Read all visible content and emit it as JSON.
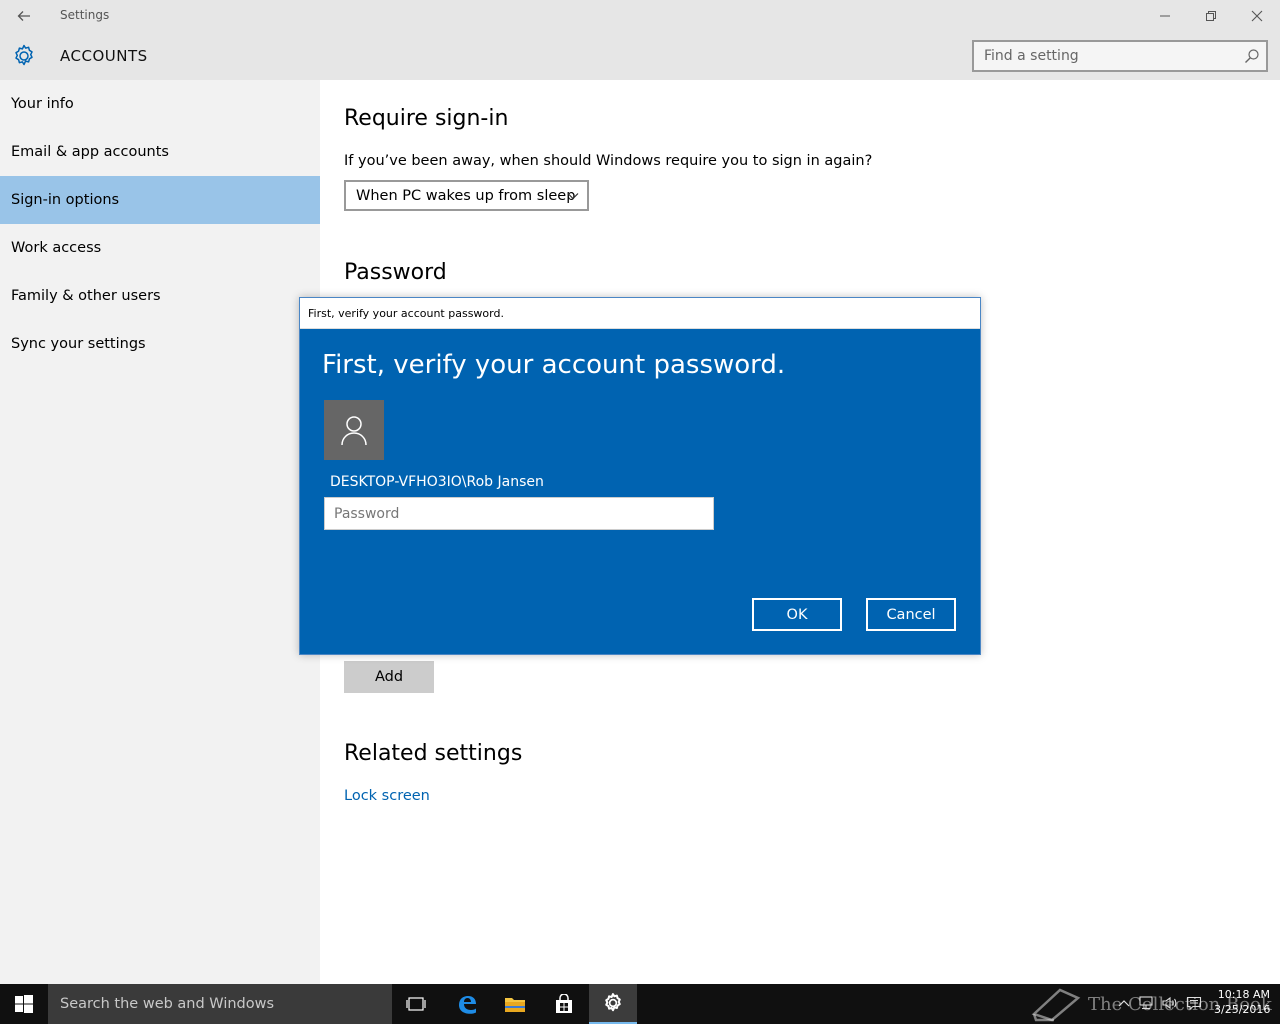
{
  "window": {
    "title": "Settings",
    "back_icon": "back-arrow-icon",
    "minimize_icon": "minimize-icon",
    "restore_icon": "restore-icon",
    "close_icon": "close-icon"
  },
  "header": {
    "title": "ACCOUNTS",
    "icon": "gear-icon",
    "search": {
      "placeholder": "Find a setting",
      "value": ""
    }
  },
  "sidebar": {
    "items": [
      {
        "label": "Your info",
        "active": false
      },
      {
        "label": "Email & app accounts",
        "active": false
      },
      {
        "label": "Sign-in options",
        "active": true
      },
      {
        "label": "Work access",
        "active": false
      },
      {
        "label": "Family & other users",
        "active": false
      },
      {
        "label": "Sync your settings",
        "active": false
      }
    ]
  },
  "main": {
    "require_signin": {
      "heading": "Require sign-in",
      "question": "If you’ve been away, when should Windows require you to sign in again?",
      "selected_option": "When PC wakes up from sleep"
    },
    "password": {
      "heading": "Password"
    },
    "add_button": "Add",
    "related": {
      "heading": "Related settings",
      "link": "Lock screen"
    }
  },
  "dialog": {
    "title_bar": "First, verify your account password.",
    "heading": "First, verify your account password.",
    "user": "DESKTOP-VFHO3IO\\Rob Jansen",
    "password_placeholder": "Password",
    "password_value": "",
    "ok_label": "OK",
    "cancel_label": "Cancel"
  },
  "taskbar": {
    "search_text": "Search the web and Windows",
    "icons": [
      "windows-start-icon",
      "task-view-icon",
      "edge-icon",
      "file-explorer-icon",
      "store-icon",
      "settings-icon"
    ],
    "watermark": "The Collection Book",
    "time": "10:18 AM",
    "date": "3/25/2016"
  },
  "colors": {
    "accent": "#0063b1",
    "selected_nav": "#99c4e8",
    "sidebar_bg": "#f2f2f2",
    "header_bg": "#e6e6e6",
    "taskbar_bg": "#101010"
  }
}
